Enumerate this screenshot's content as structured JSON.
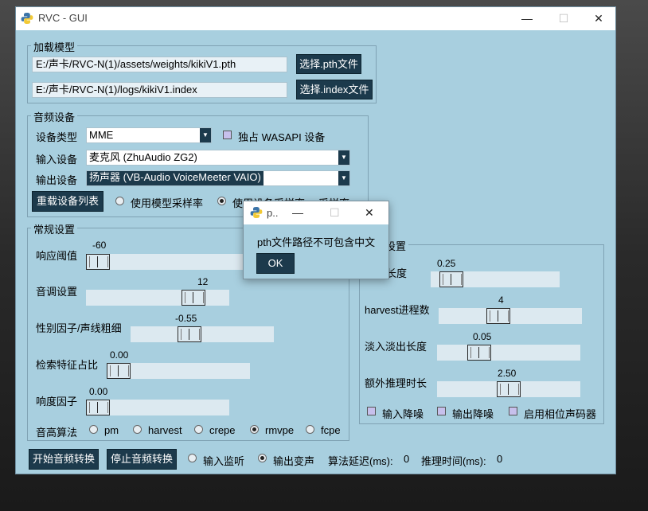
{
  "window": {
    "title": "RVC - GUI",
    "controls": {
      "minimize": "—",
      "maximize": "☐",
      "close": "✕"
    }
  },
  "load_model": {
    "legend": "加载模型",
    "pth_path": "E:/声卡/RVC-N(1)/assets/weights/kikiV1.pth",
    "index_path": "E:/声卡/RVC-N(1)/logs/kikiV1.index",
    "pth_button": "选择.pth文件",
    "index_button": "选择.index文件"
  },
  "audio_device": {
    "legend": "音频设备",
    "type_label": "设备类型",
    "type_value": "MME",
    "exclusive_label": "独占 WASAPI 设备",
    "input_label": "输入设备",
    "input_value": "麦克风 (ZhuAudio ZG2)",
    "output_label": "输出设备",
    "output_value": "扬声器 (VB-Audio VoiceMeeter VAIO)",
    "reload_button": "重载设备列表",
    "use_model_sr": "使用模型采样率",
    "use_device_sr": "使用设备采样率",
    "sr_label": "采样率:"
  },
  "general": {
    "legend": "常规设置",
    "threshold_label": "响应阈值",
    "threshold_value": "-60",
    "pitch_label": "音调设置",
    "pitch_value": "12",
    "formant_label": "性别因子/声线粗细",
    "formant_value": "-0.55",
    "index_rate_label": "检索特征占比",
    "index_rate_value": "0.00",
    "rms_label": "响度因子",
    "rms_value": "0.00",
    "f0_label": "音高算法",
    "f0_options": [
      "pm",
      "harvest",
      "crepe",
      "rmvpe",
      "fcpe"
    ],
    "f0_selected": "rmvpe"
  },
  "performance": {
    "legend_tail": "设置",
    "block_label_tail": "长度",
    "block_value": "0.25",
    "harvest_label": "harvest进程数",
    "harvest_value": "4",
    "crossfade_label": "淡入淡出长度",
    "crossfade_value": "0.05",
    "extra_label": "额外推理时长",
    "extra_value": "2.50",
    "input_denoise": "输入降噪",
    "output_denoise": "输出降噪",
    "phase_vocoder": "启用相位声码器"
  },
  "bottom": {
    "start_button": "开始音频转换",
    "stop_button": "停止音频转换",
    "input_monitor": "输入监听",
    "output_voice": "输出变声",
    "delay_label": "算法延迟(ms):",
    "delay_value": "0",
    "infer_label": "推理时间(ms):",
    "infer_value": "0"
  },
  "popup": {
    "title": "p..",
    "message": "pth文件路径不可包含中文",
    "ok_button": "OK"
  },
  "slider_levels": {
    "threshold": 0.0,
    "pitch": 0.8,
    "formant": 0.39,
    "index_rate": 0.0,
    "rms": 0.0,
    "block": 0.08,
    "harvest": 0.4,
    "crossfade": 0.25,
    "extra": 0.5
  }
}
